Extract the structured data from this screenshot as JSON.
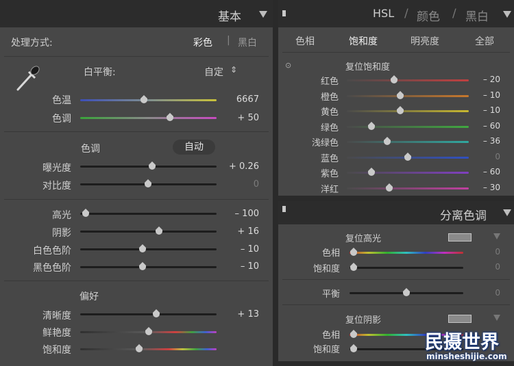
{
  "basic": {
    "title": "基本",
    "treatment_label": "处理方式:",
    "treatment_color": "彩色",
    "treatment_sep": "|",
    "treatment_bw": "黑白",
    "wb_label": "白平衡:",
    "wb_value": "自定",
    "wb_arrows": "⇕",
    "temp": {
      "label": "色温",
      "value": "6667",
      "position": 0.47
    },
    "tint": {
      "label": "色调",
      "value": "+ 50",
      "position": 0.66
    },
    "tone_title": "色调",
    "auto_label": "自动",
    "exposure": {
      "label": "曝光度",
      "value": "+ 0.26",
      "position": 0.53
    },
    "contrast": {
      "label": "对比度",
      "value": "0",
      "position": 0.5
    },
    "highlights": {
      "label": "高光",
      "value": "– 100",
      "position": 0.0
    },
    "shadows": {
      "label": "阴影",
      "value": "+ 16",
      "position": 0.58
    },
    "whites": {
      "label": "白色色阶",
      "value": "– 10",
      "position": 0.45
    },
    "blacks": {
      "label": "黑色色阶",
      "value": "– 10",
      "position": 0.45
    },
    "presence_title": "偏好",
    "clarity": {
      "label": "清晰度",
      "value": "+ 13",
      "position": 0.56
    },
    "vibrance": {
      "label": "鲜艳度",
      "value": "",
      "position": 0.5
    },
    "saturation": {
      "label": "饱和度",
      "value": "",
      "position": 0.43
    }
  },
  "hsl": {
    "title_hsl": "HSL",
    "title_sep1": "/",
    "title_color": "颜色",
    "title_sep2": "/",
    "title_bw": "黑白",
    "tabs": [
      "色相",
      "饱和度",
      "明亮度",
      "全部"
    ],
    "active_tab": "饱和度",
    "target_icon": "⊙",
    "reset_label": "复位饱和度",
    "rows": [
      {
        "label": "红色",
        "value": "– 20",
        "position": 0.39,
        "color": "#c04040"
      },
      {
        "label": "橙色",
        "value": "– 10",
        "position": 0.44,
        "color": "#c8782c"
      },
      {
        "label": "黄色",
        "value": "– 10",
        "position": 0.44,
        "color": "#c8b830"
      },
      {
        "label": "绿色",
        "value": "– 60",
        "position": 0.2,
        "color": "#40a840"
      },
      {
        "label": "浅绿色",
        "value": "– 36",
        "position": 0.33,
        "color": "#30a8a0"
      },
      {
        "label": "蓝色",
        "value": "0",
        "position": 0.5,
        "color": "#3050c0"
      },
      {
        "label": "紫色",
        "value": "– 60",
        "position": 0.2,
        "color": "#8040c0"
      },
      {
        "label": "洋红",
        "value": "– 30",
        "position": 0.35,
        "color": "#c040a0"
      }
    ]
  },
  "split": {
    "title": "分离色调",
    "highlights_reset": "复位高光",
    "hl_hue": {
      "label": "色相",
      "value": "0",
      "position": 0.0
    },
    "hl_sat": {
      "label": "饱和度",
      "value": "0",
      "position": 0.0
    },
    "balance": {
      "label": "平衡",
      "value": "0",
      "position": 0.5
    },
    "shadows_reset": "复位阴影",
    "sh_hue": {
      "label": "色相",
      "value": "",
      "position": 0.0
    },
    "sh_sat": {
      "label": "饱和度",
      "value": "",
      "position": 0.0
    }
  },
  "watermark": {
    "logo_text": "民摄世界",
    "url": "minsheshijie.com"
  },
  "colors": {
    "panel_bg": "#474747",
    "header_bg": "#2c2c2c",
    "text": "#cfcfcf"
  }
}
